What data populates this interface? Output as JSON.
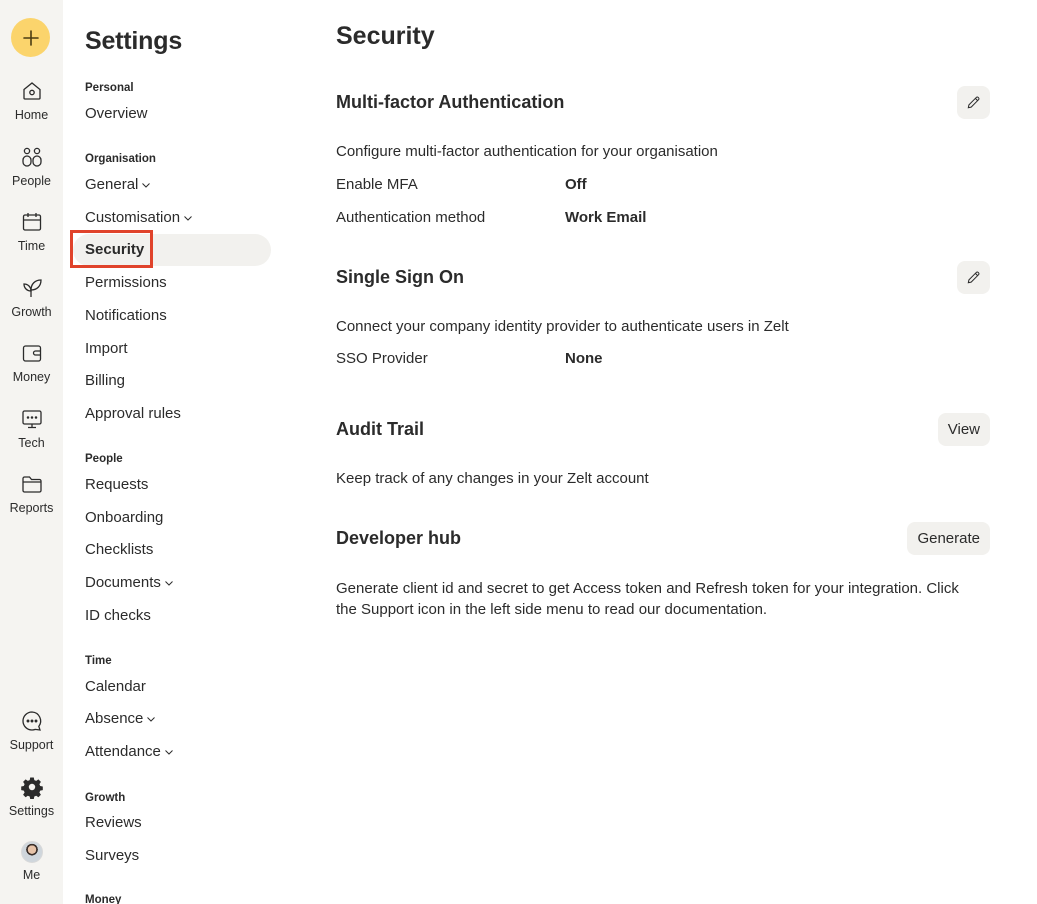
{
  "rail": {
    "items": [
      {
        "label": "Home",
        "icon": "home-icon"
      },
      {
        "label": "People",
        "icon": "people-icon"
      },
      {
        "label": "Time",
        "icon": "calendar-icon"
      },
      {
        "label": "Growth",
        "icon": "leaf-icon"
      },
      {
        "label": "Money",
        "icon": "wallet-icon"
      },
      {
        "label": "Tech",
        "icon": "monitor-icon"
      },
      {
        "label": "Reports",
        "icon": "folder-icon"
      }
    ],
    "bottom": [
      {
        "label": "Support",
        "icon": "chat-icon"
      },
      {
        "label": "Settings",
        "icon": "gear-icon"
      },
      {
        "label": "Me",
        "icon": "avatar"
      }
    ]
  },
  "sidebar": {
    "title": "Settings",
    "groups": {
      "personal": "Personal",
      "organisation": "Organisation",
      "people": "People",
      "time": "Time",
      "growth": "Growth",
      "money": "Money"
    },
    "items": {
      "overview": "Overview",
      "general": "General",
      "customisation": "Customisation",
      "security": "Security",
      "permissions": "Permissions",
      "notifications": "Notifications",
      "import": "Import",
      "billing": "Billing",
      "approval_rules": "Approval rules",
      "requests": "Requests",
      "onboarding": "Onboarding",
      "checklists": "Checklists",
      "documents": "Documents",
      "id_checks": "ID checks",
      "calendar": "Calendar",
      "absence": "Absence",
      "attendance": "Attendance",
      "reviews": "Reviews",
      "surveys": "Surveys"
    }
  },
  "main": {
    "title": "Security",
    "mfa": {
      "title": "Multi-factor Authentication",
      "description": "Configure multi-factor authentication for your organisation",
      "rows": [
        {
          "label": "Enable MFA",
          "value": "Off"
        },
        {
          "label": "Authentication method",
          "value": "Work Email"
        }
      ]
    },
    "sso": {
      "title": "Single Sign On",
      "description": "Connect your company identity provider to authenticate users in Zelt",
      "rows": [
        {
          "label": "SSO Provider",
          "value": "None"
        }
      ]
    },
    "audit": {
      "title": "Audit Trail",
      "description": "Keep track of any changes in your Zelt account",
      "button": "View"
    },
    "developer": {
      "title": "Developer hub",
      "description": "Generate client id and secret to get Access token and Refresh token for your integration. Click the Support icon in the left side menu to read our documentation.",
      "button": "Generate"
    }
  },
  "colors": {
    "rail_bg": "#f5f4f1",
    "add_button": "#fbd46c",
    "highlight": "#e0432b",
    "active_bg": "#f2f1ee",
    "button_bg": "#f2f1ee"
  }
}
